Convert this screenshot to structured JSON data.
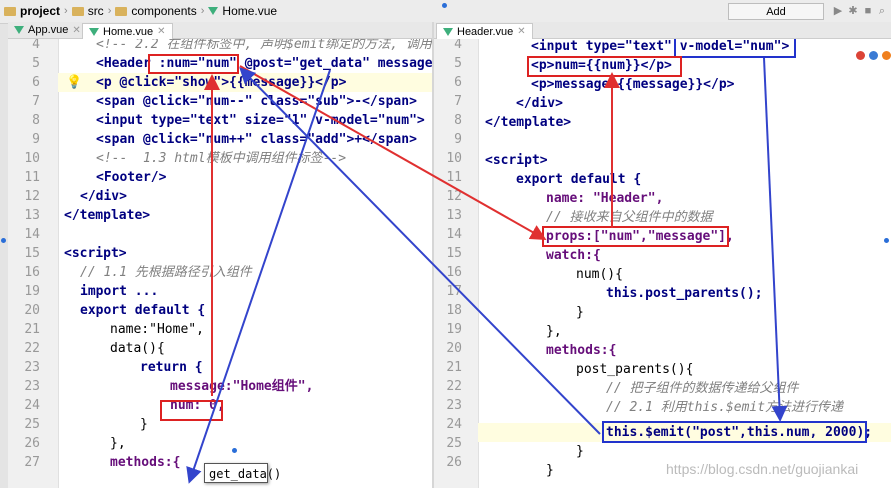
{
  "breadcrumb": {
    "project": "project",
    "src": "src",
    "components": "components",
    "file": "Home.vue"
  },
  "toolbar": {
    "add_config": "Add Configuration..."
  },
  "tabs_left": [
    {
      "label": "App.vue"
    },
    {
      "label": "Home.vue"
    }
  ],
  "tabs_right": [
    {
      "label": "Header.vue"
    }
  ],
  "left_lines": [
    {
      "n": "4",
      "t": "<!-- 2.2 在组件标签中, 声明$emit绑定的方法, 调用"
    },
    {
      "n": "5",
      "t": "<Header :num=\"num\" @post=\"get_data\" message="
    },
    {
      "n": "6",
      "t": "<p @click=\"show\">{{message}}</p>"
    },
    {
      "n": "7",
      "t": "<span @click=\"num--\" class=\"sub\">-</span>"
    },
    {
      "n": "8",
      "t": "<input type=\"text\" size=\"1\" v-model=\"num\">"
    },
    {
      "n": "9",
      "t": "<span @click=\"num++\" class=\"add\">+</span>"
    },
    {
      "n": "10",
      "t": "<!--  1.3 html模板中调用组件标签-->"
    },
    {
      "n": "11",
      "t": "<Footer/>"
    },
    {
      "n": "12",
      "t": "</div>"
    },
    {
      "n": "13",
      "t": "</template>"
    },
    {
      "n": "14",
      "t": ""
    },
    {
      "n": "15",
      "t": "<script>"
    },
    {
      "n": "16",
      "t": "// 1.1 先根据路径引入组件"
    },
    {
      "n": "19",
      "t": "import ..."
    },
    {
      "n": "20",
      "t": "export default {"
    },
    {
      "n": "21",
      "t": "name:\"Home\","
    },
    {
      "n": "22",
      "t": "data(){"
    },
    {
      "n": "23",
      "t": "return {"
    },
    {
      "n": "23b",
      "t": "message:\"Home组件\","
    },
    {
      "n": "24",
      "t": "num: 0,"
    },
    {
      "n": "25",
      "t": "}"
    },
    {
      "n": "26",
      "t": "},"
    },
    {
      "n": "27",
      "t": "methods:{"
    }
  ],
  "right_lines": [
    {
      "n": "4",
      "t": "<input type=\"text\" v-model=\"num\">"
    },
    {
      "n": "5",
      "t": "<p>num={{num}}</p>"
    },
    {
      "n": "6",
      "t": "<p>message:{{message}}</p>"
    },
    {
      "n": "7",
      "t": "</div>"
    },
    {
      "n": "8",
      "t": "</template>"
    },
    {
      "n": "9",
      "t": ""
    },
    {
      "n": "10",
      "t": "<script>"
    },
    {
      "n": "11",
      "t": "export default {"
    },
    {
      "n": "12",
      "t": "name: \"Header\","
    },
    {
      "n": "13",
      "t": "// 接收来自父组件中的数据"
    },
    {
      "n": "14",
      "t": "props:[\"num\",\"message\"],"
    },
    {
      "n": "15",
      "t": "watch:{"
    },
    {
      "n": "16",
      "t": "num(){"
    },
    {
      "n": "17",
      "t": "this.post_parents();"
    },
    {
      "n": "18",
      "t": "}"
    },
    {
      "n": "19",
      "t": "},"
    },
    {
      "n": "20",
      "t": "methods:{"
    },
    {
      "n": "21",
      "t": "post_parents(){"
    },
    {
      "n": "22",
      "t": "// 把子组件的数据传递给父组件"
    },
    {
      "n": "23",
      "t": "// 2.1 利用this.$emit方法进行传递"
    },
    {
      "n": "24",
      "t": "this.$emit(\"post\",this.num, 2000);"
    },
    {
      "n": "25",
      "t": "}"
    },
    {
      "n": "26",
      "t": "}"
    }
  ],
  "popup": {
    "text": "get_data()"
  },
  "watermark": "https://blog.csdn.net/guojiankai",
  "colors": {
    "red_box": "#d22222",
    "blue_box": "#2233cc",
    "arrow_red": "#e03030",
    "arrow_blue": "#3344cc"
  }
}
